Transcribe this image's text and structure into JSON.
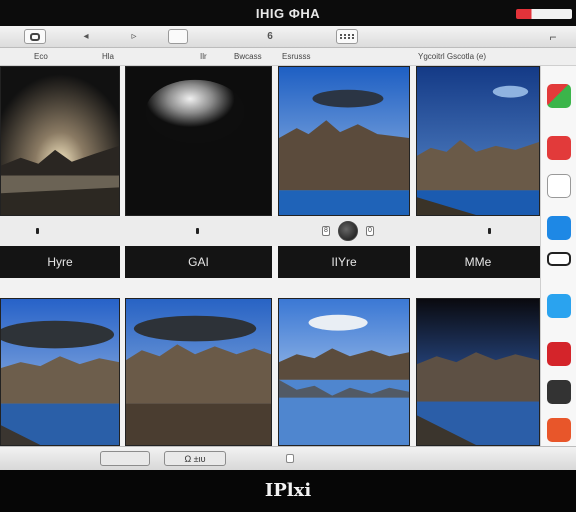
{
  "window": {
    "title": "ІНІG ФНА"
  },
  "toolbar": {
    "items": [
      {
        "icon": "back-icon"
      },
      {
        "icon": "arrow-left-icon"
      },
      {
        "icon": "arrow-right-icon"
      },
      {
        "icon": "folder-icon"
      },
      {
        "label": "6"
      },
      {
        "icon": "keyboard-icon"
      },
      {
        "icon": "pen-icon"
      }
    ]
  },
  "column_headers": [
    "Eco",
    "Hla",
    "Ilr",
    "Bwcass",
    "Esrusss",
    "Ygcoitrl Gscotla (e)"
  ],
  "photos": {
    "row1": [
      {
        "scene": "night-lake"
      },
      {
        "scene": "blurred-light"
      },
      {
        "scene": "mountain-lake"
      },
      {
        "scene": "mountain-lake-2"
      }
    ],
    "row2": [
      {
        "scene": "clouds-lake"
      },
      {
        "scene": "clouds-cliffs"
      },
      {
        "scene": "reflection"
      },
      {
        "scene": "dark-ridge"
      }
    ]
  },
  "labels": [
    "Hyre",
    "GAI",
    "IIYre",
    "MMe"
  ],
  "player": {
    "left": "8",
    "right": "0"
  },
  "sidebar": {
    "icons": [
      {
        "name": "maps-app-icon",
        "color": "#3bb54a"
      },
      {
        "name": "red-app-icon",
        "color": "#e23a3a"
      },
      {
        "name": "white-app-icon",
        "color": "#ffffff"
      },
      {
        "name": "blue-app-icon",
        "color": "#1e88e5"
      },
      {
        "name": "toggle-app-icon",
        "color": "#222222"
      },
      {
        "name": "cloud-app-icon",
        "color": "#2aa3ef"
      },
      {
        "name": "bag-app-icon",
        "color": "#d4242a"
      },
      {
        "name": "dark-app-icon",
        "color": "#333333"
      },
      {
        "name": "orange-app-icon",
        "color": "#e8562a"
      }
    ]
  },
  "bottom": {
    "switch_label": "Ω ±ιυ"
  },
  "brand": {
    "text": "IPlxi"
  },
  "colors": {
    "accent": "#e3333a",
    "sky": "#2d6fcf",
    "dark": "#0b0b0b"
  }
}
